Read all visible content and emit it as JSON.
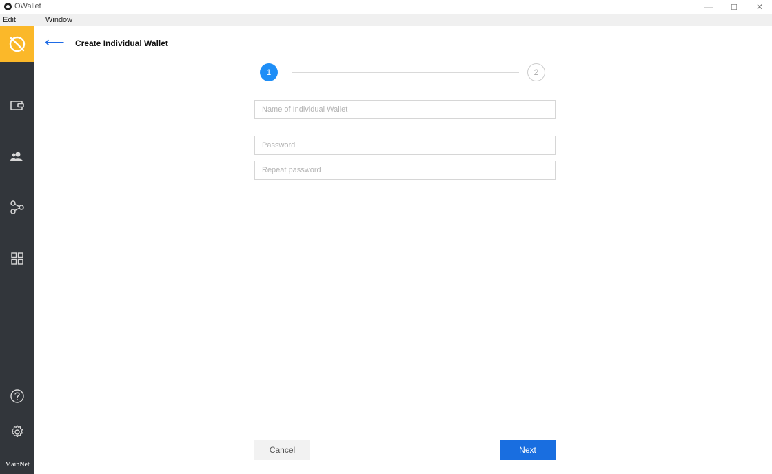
{
  "window": {
    "title": "OWallet",
    "minimize_glyph": "—",
    "maximize_glyph": "☐",
    "close_glyph": "✕"
  },
  "menu": {
    "items": [
      {
        "label": "Edit"
      },
      {
        "label": "Window"
      }
    ]
  },
  "sidebar": {
    "brand_icon": "ontology-logo-icon",
    "brand_color": "#fbb829",
    "background": "#32363b",
    "items": [
      {
        "icon": "wallet-icon"
      },
      {
        "icon": "contacts-icon"
      },
      {
        "icon": "node-stake-icon"
      },
      {
        "icon": "dapps-grid-icon"
      },
      {
        "icon": "help-icon"
      },
      {
        "icon": "settings-gear-icon"
      }
    ],
    "network_label": "MainNet"
  },
  "header": {
    "back_glyph": "⟵",
    "title": "Create Individual Wallet"
  },
  "stepper": {
    "steps": [
      "1",
      "2"
    ],
    "active_step": 1,
    "active_color": "#1e8ef7"
  },
  "form": {
    "wallet_name": {
      "value": "",
      "placeholder": "Name of Individual Wallet"
    },
    "password": {
      "value": "",
      "placeholder": "Password"
    },
    "repeat_password": {
      "value": "",
      "placeholder": "Repeat password"
    }
  },
  "actions": {
    "cancel_label": "Cancel",
    "next_label": "Next",
    "next_color": "#196ee0"
  }
}
